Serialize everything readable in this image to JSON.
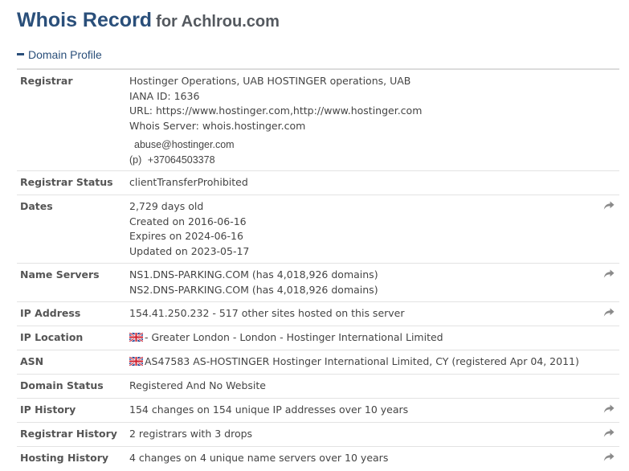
{
  "header": {
    "title": "Whois Record",
    "for_domain": "for Achlrou.com"
  },
  "section": {
    "label": "Domain Profile"
  },
  "registrar": {
    "label": "Registrar",
    "name": "Hostinger Operations, UAB HOSTINGER operations, UAB",
    "iana": "IANA ID: 1636",
    "url": "URL: https://www.hostinger.com,http://www.hostinger.com",
    "whois_server": "Whois Server: whois.hostinger.com",
    "email": "abuse@hostinger.com",
    "phone_prefix": "(p)",
    "phone": "+37064503378"
  },
  "registrar_status": {
    "label": "Registrar Status",
    "value": "clientTransferProhibited"
  },
  "dates": {
    "label": "Dates",
    "age": "2,729 days old",
    "created": "Created on 2016-06-16",
    "expires": "Expires on 2024-06-16",
    "updated": "Updated on 2023-05-17"
  },
  "name_servers": {
    "label": "Name Servers",
    "ns1": "NS1.DNS-PARKING.COM (has 4,018,926 domains)",
    "ns2": "NS2.DNS-PARKING.COM (has 4,018,926 domains)"
  },
  "ip_address": {
    "label": "IP Address",
    "value": "154.41.250.232 - 517 other sites hosted on this server"
  },
  "ip_location": {
    "label": "IP Location",
    "value": "- Greater London - London - Hostinger International Limited"
  },
  "asn": {
    "label": "ASN",
    "value": "AS47583 AS-HOSTINGER Hostinger International Limited, CY (registered Apr 04, 2011)"
  },
  "domain_status": {
    "label": "Domain Status",
    "value": "Registered And No Website"
  },
  "ip_history": {
    "label": "IP History",
    "value": "154 changes on 154 unique IP addresses over 10 years"
  },
  "registrar_history": {
    "label": "Registrar History",
    "value": "2 registrars with 3 drops"
  },
  "hosting_history": {
    "label": "Hosting History",
    "value": "4 changes on 4 unique name servers over 10 years"
  },
  "colors": {
    "title": "#2a4f7a",
    "label": "#555555",
    "share_icon": "#8a8a8a"
  },
  "icons": {
    "share": "share-arrow-icon",
    "flag": "uk-flag-icon",
    "collapse": "minus-icon"
  }
}
